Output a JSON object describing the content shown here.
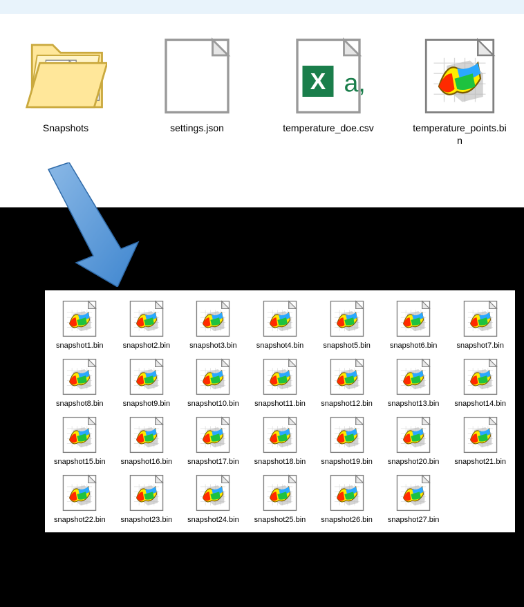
{
  "top": {
    "items": [
      {
        "name": "Snapshots",
        "type": "folder"
      },
      {
        "name": "settings.json",
        "type": "blank"
      },
      {
        "name": "temperature_doe.csv",
        "type": "csv"
      },
      {
        "name": "temperature_points.bin",
        "type": "bin"
      }
    ]
  },
  "snapshots": [
    "snapshot1.bin",
    "snapshot2.bin",
    "snapshot3.bin",
    "snapshot4.bin",
    "snapshot5.bin",
    "snapshot6.bin",
    "snapshot7.bin",
    "snapshot8.bin",
    "snapshot9.bin",
    "snapshot10.bin",
    "snapshot11.bin",
    "snapshot12.bin",
    "snapshot13.bin",
    "snapshot14.bin",
    "snapshot15.bin",
    "snapshot16.bin",
    "snapshot17.bin",
    "snapshot18.bin",
    "snapshot19.bin",
    "snapshot20.bin",
    "snapshot21.bin",
    "snapshot22.bin",
    "snapshot23.bin",
    "snapshot24.bin",
    "snapshot25.bin",
    "snapshot26.bin",
    "snapshot27.bin"
  ]
}
